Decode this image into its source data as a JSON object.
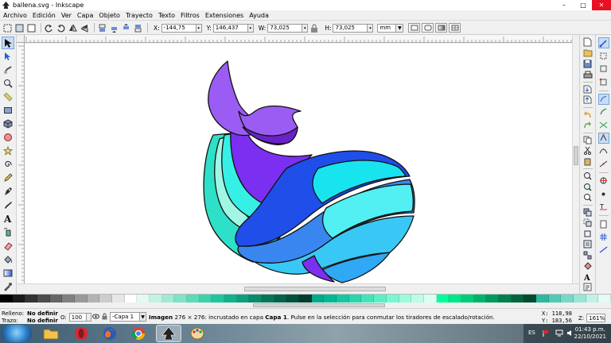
{
  "window": {
    "title": "ballena.svg - Inkscape",
    "minimize": "–",
    "maximize": "□",
    "close": "✕"
  },
  "menu": [
    "Archivo",
    "Edición",
    "Ver",
    "Capa",
    "Objeto",
    "Trayecto",
    "Texto",
    "Filtros",
    "Extensiones",
    "Ayuda"
  ],
  "controls": {
    "x_label": "X:",
    "x_value": "-144,75",
    "y_label": "Y:",
    "y_value": "146,437",
    "w_label": "W:",
    "w_value": "73,025",
    "h_label": "H:",
    "h_value": "73,025",
    "unit": "mm"
  },
  "whale_colors": {
    "tail": "#9a5cf2",
    "tail_shadow": "#6a22c8",
    "body_purple": "#7b2ff0",
    "teal": "#2fe0c8",
    "aqua": "#36f0e6",
    "mint": "#9ff7e4",
    "blue": "#1f4ee8",
    "mid_blue": "#3a86f0",
    "light_blue": "#39c8f5",
    "cyan": "#18e4f0",
    "cyan_light": "#52f0f2",
    "belly_blue": "#2fa8f5",
    "outline": "#111111"
  },
  "palette": [
    "#000000",
    "#1a1a1a",
    "#333333",
    "#4d4d4d",
    "#666666",
    "#808080",
    "#999999",
    "#b3b3b3",
    "#cccccc",
    "#e6e6e6",
    "#ffffff",
    "#e3f9f2",
    "#c2f2e4",
    "#a2ead4",
    "#7fe3c5",
    "#5edab7",
    "#3dd1a9",
    "#1fc69c",
    "#12b38c",
    "#0e9f7c",
    "#0a8a6b",
    "#06765b",
    "#04624b",
    "#024f3c",
    "#023c2d",
    "#00aa88",
    "#00b894",
    "#17c79f",
    "#2ad6ab",
    "#43e3b9",
    "#5cefc6",
    "#7af7d2",
    "#9bfbdd",
    "#bcfde8",
    "#d9fff3",
    "#00ff99",
    "#00e68a",
    "#00cc7a",
    "#00b36b",
    "#00995c",
    "#00804d",
    "#00663d",
    "#004d2e",
    "#2eb8a0",
    "#52c9b3",
    "#76d9c6",
    "#9ae6d6",
    "#bff1e6",
    "#e3faf5"
  ],
  "status": {
    "fill_label": "Relleno:",
    "fill_value": "No definir",
    "stroke_label": "Trazo:",
    "stroke_value": "No definir",
    "opacity_label": "O:",
    "opacity_value": "100",
    "layer": "-Capa 1",
    "msg_bold": "Imagen",
    "msg_mid": " 276 × 276: incrustado en capa ",
    "msg_layer": "Capa 1",
    "msg_tail": ". Pulse en la selección para conmutar los tiradores de escalado/rotación.",
    "x_label": "X:",
    "x_value": "118,98",
    "y_label": "Y:",
    "y_value": "183,56",
    "zoom_label": "Z:",
    "zoom_value": "161%"
  },
  "taskbar": {
    "language": "ES",
    "time": "01:43 p.m.",
    "date": "22/10/2021"
  }
}
